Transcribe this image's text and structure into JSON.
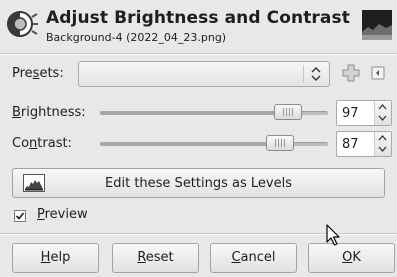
{
  "header": {
    "title": "Adjust Brightness and Contrast",
    "subtitle": "Background-4 (2022_04_23.png)",
    "icon": "brightness-contrast-icon"
  },
  "presets": {
    "label": "Presets:",
    "mnemonic": "s",
    "value": "",
    "add_icon": "plus-icon",
    "menu_icon": "tab-menu-icon"
  },
  "brightness": {
    "label": "Brightness:",
    "mnemonic": "B",
    "value": "97",
    "range": [
      -127,
      127
    ]
  },
  "contrast": {
    "label": "Contrast:",
    "mnemonic": "n",
    "value": "87",
    "range": [
      -127,
      127
    ]
  },
  "levels_button": {
    "label": "Edit these Settings as Levels",
    "icon": "levels-icon"
  },
  "preview": {
    "label": "Preview",
    "checked": true
  },
  "buttons": {
    "help": "Help",
    "reset": "Reset",
    "cancel": "Cancel",
    "ok": "OK"
  }
}
